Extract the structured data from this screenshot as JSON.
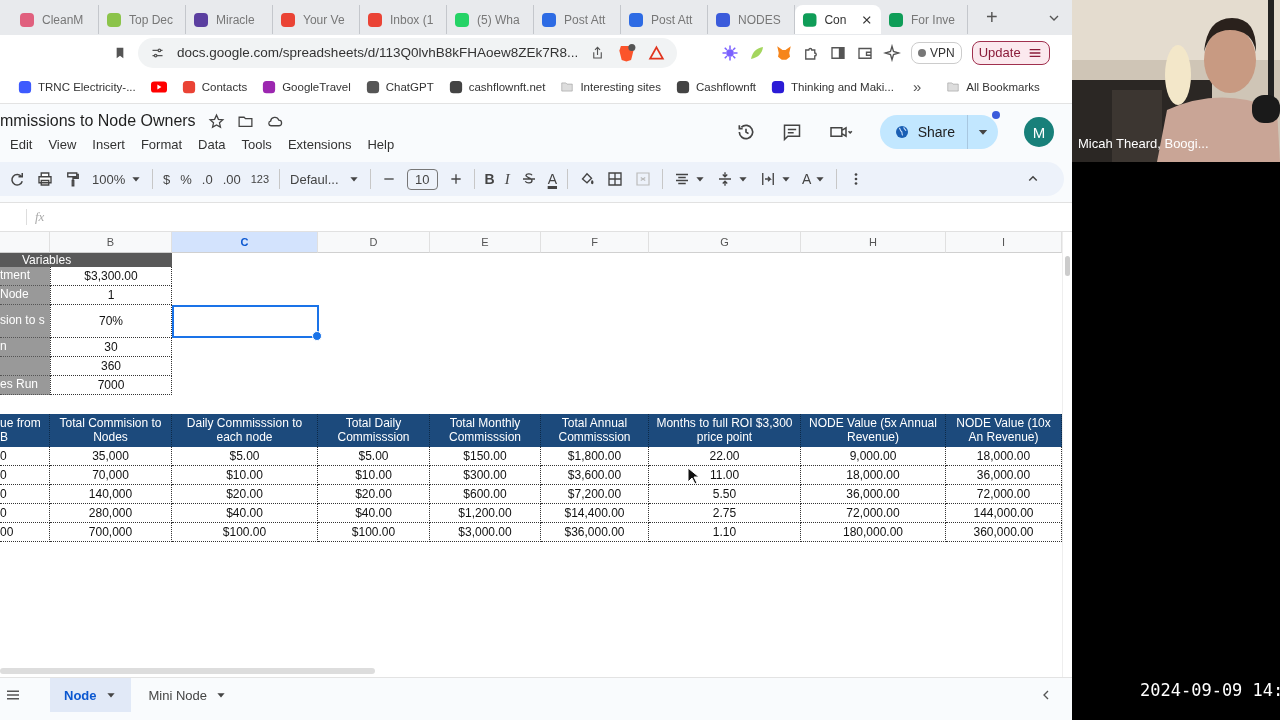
{
  "browser": {
    "tabs": [
      {
        "label": "CleanM",
        "selected": false,
        "color": "#e0607e"
      },
      {
        "label": "Top Dec",
        "selected": false,
        "color": "#8bc34a"
      },
      {
        "label": "Miracle",
        "selected": false,
        "color": "#5b3fa0"
      },
      {
        "label": "Your Ve",
        "selected": false,
        "color": "#ea4335"
      },
      {
        "label": "Inbox (1",
        "selected": false,
        "color": "#ea4335"
      },
      {
        "label": "(5) Wha",
        "selected": false,
        "color": "#25d366"
      },
      {
        "label": "Post Att",
        "selected": false,
        "color": "#2d6be4"
      },
      {
        "label": "Post Att",
        "selected": false,
        "color": "#2d6be4"
      },
      {
        "label": "NODES",
        "selected": false,
        "color": "#3b5bdb"
      },
      {
        "label": "Con",
        "selected": true,
        "color": "#0f9d58"
      },
      {
        "label": "For Inve",
        "selected": false,
        "color": "#0f9d58"
      }
    ],
    "new_tab": "+",
    "url": "docs.google.com/spreadsheets/d/113Q0lvhB8kFHAoew8ZEk7R8...",
    "vpn": "VPN",
    "update": "Update"
  },
  "bookmarks": [
    {
      "kind": "site",
      "label": "TRNC Electricity-..."
    },
    {
      "kind": "video"
    },
    {
      "kind": "site",
      "label": "Contacts"
    },
    {
      "kind": "site",
      "label": "GoogleTravel"
    },
    {
      "kind": "site",
      "label": "ChatGPT"
    },
    {
      "kind": "site",
      "label": "cashflownft.net"
    },
    {
      "kind": "folder",
      "label": "Interesting sites"
    },
    {
      "kind": "site",
      "label": "Cashflownft"
    },
    {
      "kind": "site",
      "label": "Thinking and Maki..."
    }
  ],
  "bookmarks_more": "»",
  "all_bookmarks": "All Bookmarks",
  "doc": {
    "title": "mmissions to Node Owners",
    "menu": [
      "Edit",
      "View",
      "Insert",
      "Format",
      "Data",
      "Tools",
      "Extensions",
      "Help"
    ],
    "share": "Share",
    "avatar": "M"
  },
  "toolbar": {
    "zoom": "100%",
    "currency": "$",
    "percent": "%",
    "decrease_decimal": ".0",
    "increase_decimal": ".00",
    "number_format": "123",
    "font": "Defaul...",
    "font_size": "10",
    "bold": "B",
    "italic": "I",
    "text_color": "A",
    "rotate": "A"
  },
  "formula_bar": {
    "fx": "fx"
  },
  "sheet": {
    "columns": [
      {
        "letter": "B",
        "selected": false
      },
      {
        "letter": "C",
        "selected": true
      },
      {
        "letter": "D",
        "selected": false
      },
      {
        "letter": "E",
        "selected": false
      },
      {
        "letter": "F",
        "selected": false
      },
      {
        "letter": "G",
        "selected": false
      },
      {
        "letter": "H",
        "selected": false
      },
      {
        "letter": "I",
        "selected": false
      }
    ],
    "variables_title": "Variables",
    "variables": [
      {
        "label": "tment",
        "value": "$3,300.00",
        "selected": false
      },
      {
        "label": "Node",
        "value": "1",
        "selected": false
      },
      {
        "label": "sion to s",
        "value": "70%",
        "selected": true
      },
      {
        "label": "n",
        "value": "30",
        "selected": false
      },
      {
        "value": "360",
        "selected": false
      },
      {
        "label": "es Run",
        "value": "7000",
        "selected": false
      }
    ],
    "table": {
      "headers": [
        "ue from B",
        "Total Commision to Nodes",
        "Daily Commisssion to each node",
        "Total Daily Commisssion",
        "Total Monthly Commisssion",
        "Total Annual Commisssion",
        "Months to full ROI $3,300 price point",
        "NODE Value (5x Annual Revenue)",
        "NODE Value (10x An Revenue)"
      ],
      "rows": [
        [
          "0",
          "35,000",
          "$5.00",
          "$5.00",
          "$150.00",
          "$1,800.00",
          "22.00",
          "9,000.00",
          "18,000.00"
        ],
        [
          "0",
          "70,000",
          "$10.00",
          "$10.00",
          "$300.00",
          "$3,600.00",
          "11.00",
          "18,000.00",
          "36,000.00"
        ],
        [
          "0",
          "140,000",
          "$20.00",
          "$20.00",
          "$600.00",
          "$7,200.00",
          "5.50",
          "36,000.00",
          "72,000.00"
        ],
        [
          "0",
          "280,000",
          "$40.00",
          "$40.00",
          "$1,200.00",
          "$14,400.00",
          "2.75",
          "72,000.00",
          "144,000.00"
        ],
        [
          "00",
          "700,000",
          "$100.00",
          "$100.00",
          "$3,000.00",
          "$36,000.00",
          "1.10",
          "180,000.00",
          "360,000.00"
        ]
      ]
    }
  },
  "sheet_tabs": [
    {
      "label": "Node",
      "selected": true
    },
    {
      "label": "Mini Node",
      "selected": false
    }
  ],
  "video": {
    "name": "Micah Theard, Boogi...",
    "kind": "picture"
  },
  "timestamp": "2024-09-09 14:"
}
